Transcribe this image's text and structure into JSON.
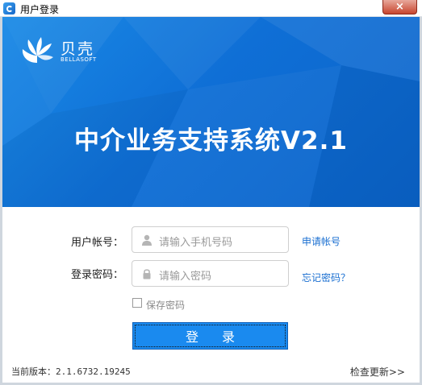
{
  "window": {
    "title": "用户登录",
    "close_label": "×"
  },
  "brand": {
    "name_cn": "贝壳",
    "name_en": "BELLASOFT"
  },
  "banner": {
    "system_title": "中介业务支持系统V2.1"
  },
  "form": {
    "account_label": "用户帐号：",
    "account_placeholder": "请输入手机号码",
    "apply_account_link": "申请帐号",
    "password_label": "登录密码：",
    "password_placeholder": "请输入密码",
    "forgot_password_link": "忘记密码？",
    "remember_password_label": "保存密码",
    "login_button": "登  录"
  },
  "footer": {
    "version_text": "当前版本：2.1.6732.19245",
    "check_update_link": "检查更新>>"
  },
  "colors": {
    "banner_blue": "#0f6fd6",
    "button_blue": "#1a8aef",
    "link_blue": "#1a6fd1"
  }
}
